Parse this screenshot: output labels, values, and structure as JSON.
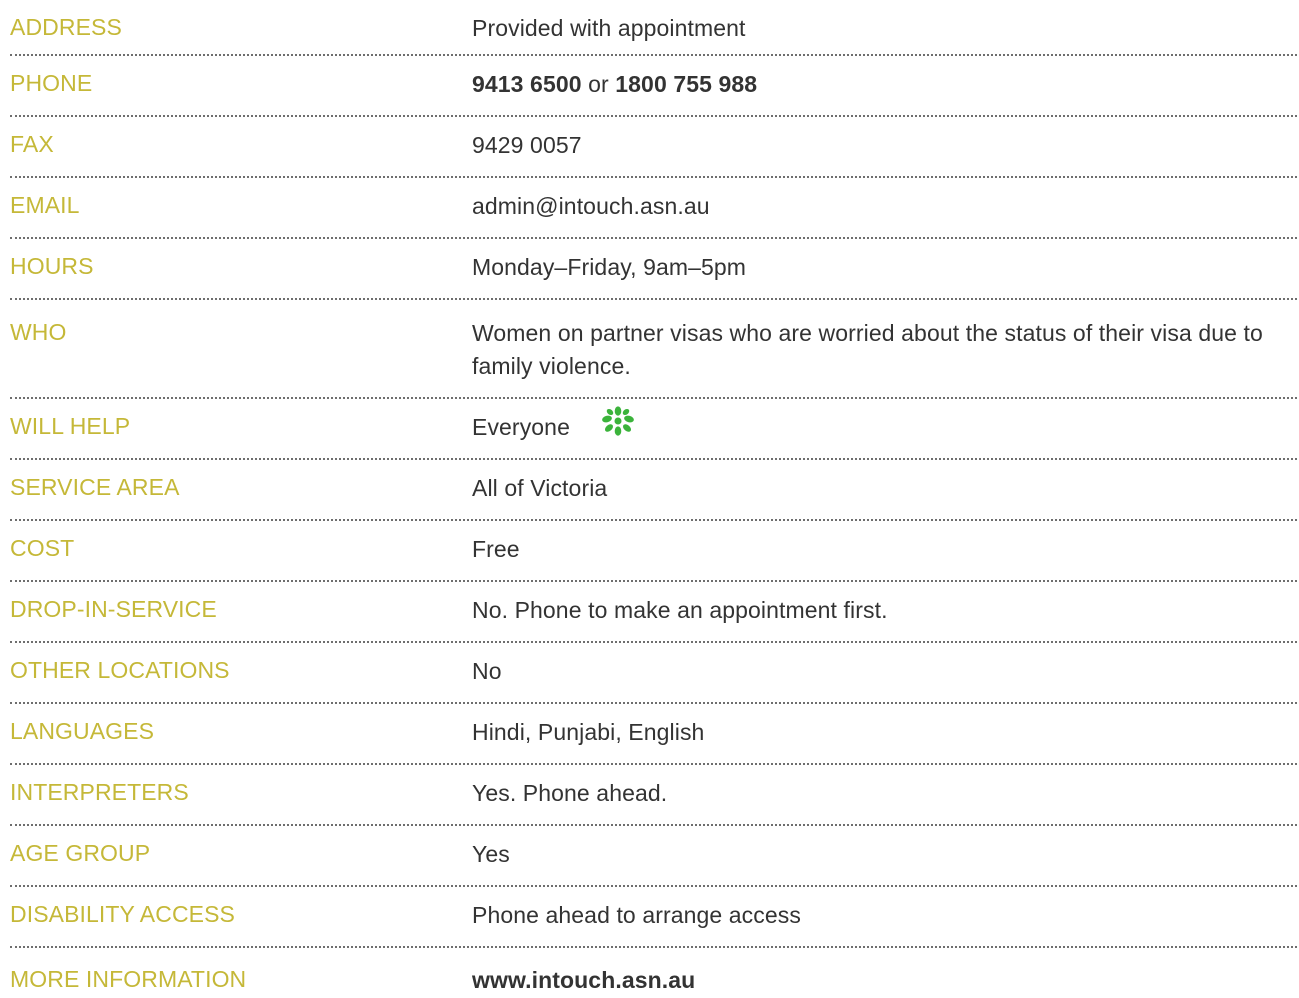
{
  "rows": [
    {
      "label": "ADDRESS",
      "value": "Provided with appointment"
    },
    {
      "label": "PHONE",
      "phone_primary": "9413 6500",
      "phone_joiner": " or ",
      "phone_secondary": "1800 755 988"
    },
    {
      "label": "FAX",
      "value": "9429 0057"
    },
    {
      "label": "EMAIL",
      "value": "admin@intouch.asn.au"
    },
    {
      "label": "HOURS",
      "value": "Monday–Friday, 9am–5pm"
    },
    {
      "label": "WHO",
      "value": "Women on partner visas who are worried about the status of their visa due to family violence."
    },
    {
      "label": "WILL HELP",
      "value": "Everyone",
      "icon": "green-flower-icon"
    },
    {
      "label": "SERVICE AREA",
      "value": "All of Victoria"
    },
    {
      "label": "COST",
      "value": "Free"
    },
    {
      "label": "DROP-IN-SERVICE",
      "value": "No. Phone to make an appointment first."
    },
    {
      "label": "OTHER LOCATIONS",
      "value": "No"
    },
    {
      "label": "LANGUAGES",
      "value": "Hindi, Punjabi, English"
    },
    {
      "label": "INTERPRETERS",
      "value": "Yes. Phone ahead."
    },
    {
      "label": "AGE GROUP",
      "value": "Yes"
    },
    {
      "label": "DISABILITY ACCESS",
      "value": "Phone ahead to arrange access"
    },
    {
      "label": "MORE INFORMATION",
      "value": "www.intouch.asn.au"
    }
  ],
  "colors": {
    "label": "#c5b838",
    "value": "#333333",
    "divider": "#6e6e6e",
    "icon": "#3bb33b"
  }
}
